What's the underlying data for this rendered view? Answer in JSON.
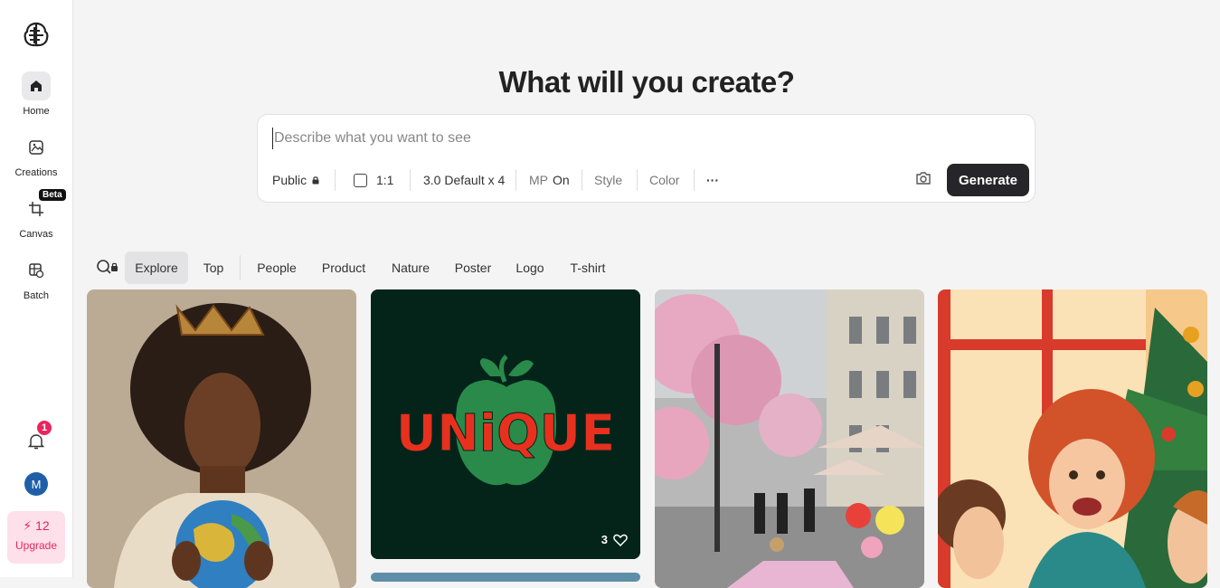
{
  "sidebar": {
    "items": [
      {
        "label": "Home",
        "icon": "home-icon",
        "active": true
      },
      {
        "label": "Creations",
        "icon": "image-icon"
      },
      {
        "label": "Canvas",
        "icon": "crop-icon",
        "badge": "Beta"
      },
      {
        "label": "Batch",
        "icon": "batch-icon"
      }
    ],
    "notifications_count": "1",
    "avatar_initial": "M",
    "upgrade": {
      "credits": "12",
      "label": "Upgrade"
    }
  },
  "main": {
    "title": "What will you create?",
    "prompt": {
      "placeholder": "Describe what you want to see",
      "value": "",
      "visibility": "Public",
      "aspect": "1:1",
      "model": "3.0 Default x 4",
      "mp_label": "MP",
      "mp_value": "On",
      "style": "Style",
      "color": "Color",
      "more": "···",
      "generate": "Generate"
    },
    "tabs": [
      "Explore",
      "Top",
      "People",
      "Product",
      "Nature",
      "Poster",
      "Logo",
      "T-shirt"
    ],
    "active_tab": "Explore",
    "gallery": [
      {
        "text": ""
      },
      {
        "text": "UNiQUE",
        "likes": "3"
      },
      {
        "text": ""
      },
      {
        "text": ""
      }
    ]
  },
  "colors": {
    "accent": "#e8265e",
    "dark": "#26262a",
    "logo_bg": "#04241a",
    "logo_red": "#e8301f",
    "logo_green": "#2a8a4a"
  }
}
